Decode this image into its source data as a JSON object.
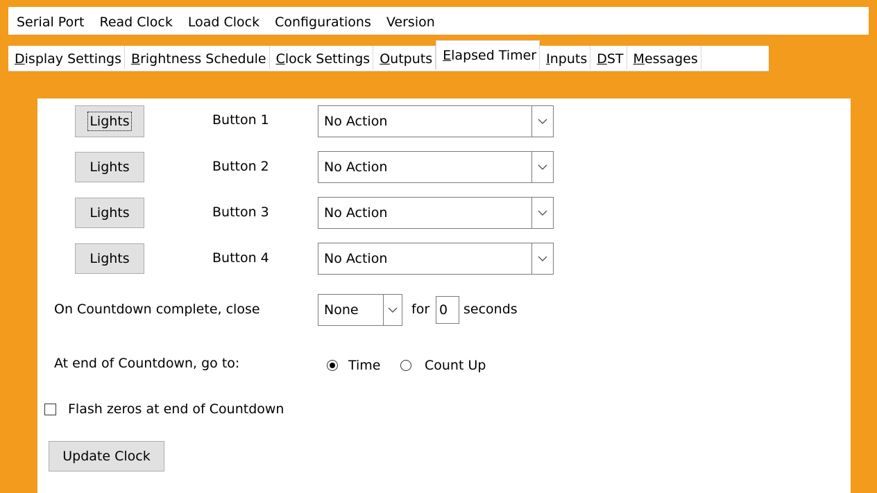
{
  "menu": [
    "Serial Port",
    "Read Clock",
    "Load Clock",
    "Configurations",
    "Version"
  ],
  "tabs": [
    {
      "u": "D",
      "rest": "isplay Settings"
    },
    {
      "u": "B",
      "rest": "rightness Schedule"
    },
    {
      "u": "C",
      "rest": "lock Settings"
    },
    {
      "u": "O",
      "rest": "utputs"
    },
    {
      "u": "E",
      "rest": "lapsed Timer"
    },
    {
      "u": "I",
      "rest": "nputs"
    },
    {
      "u": "D",
      "rest": "ST"
    },
    {
      "u": "M",
      "rest": "essages"
    }
  ],
  "active_tab": "Elapsed Timer",
  "buttons": [
    {
      "lights": "Lights",
      "label": "Button 1",
      "action": "No Action"
    },
    {
      "lights": "Lights",
      "label": "Button 2",
      "action": "No Action"
    },
    {
      "lights": "Lights",
      "label": "Button 3",
      "action": "No Action"
    },
    {
      "lights": "Lights",
      "label": "Button 4",
      "action": "No Action"
    }
  ],
  "countdown": {
    "label": "On Countdown complete, close",
    "close_value": "None",
    "for_label": "for",
    "seconds_value": "0",
    "seconds_label": "seconds"
  },
  "end_goto": {
    "label": "At end of Countdown, go to:",
    "options": [
      "Time",
      "Count Up"
    ],
    "selected": "Time"
  },
  "flash_zeros": {
    "label": "Flash zeros at end of Countdown",
    "checked": false
  },
  "update_button": "Update Clock",
  "colors": {
    "background": "#F29B1D",
    "panel": "#FFFFFF",
    "button_face": "#E1E1E1"
  }
}
